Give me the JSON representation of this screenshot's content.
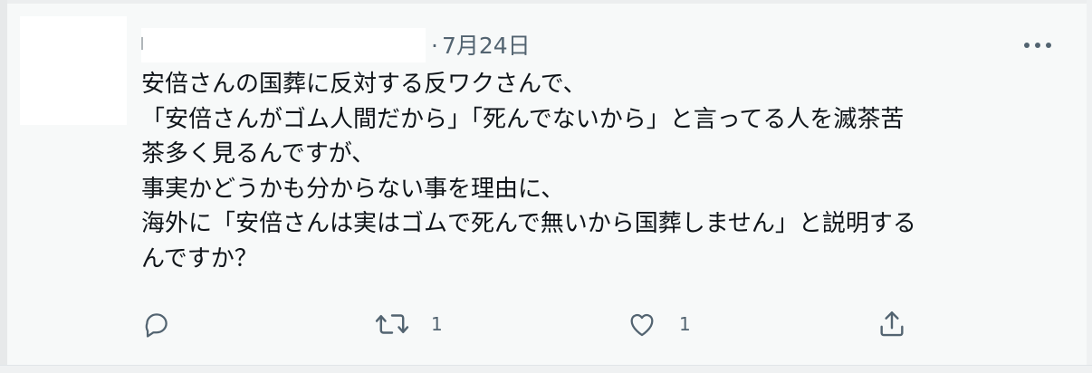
{
  "tweet": {
    "timestamp": "7月24日",
    "separator": "·",
    "text_lines": [
      "安倍さんの国葬に反対する反ワクさんで、",
      "「安倍さんがゴム人間だから」「死んでないから」と言ってる人を滅茶苦",
      "茶多く見るんですが、",
      "事実かどうかも分からない事を理由に、",
      "海外に「安倍さんは実はゴムで死んで無いから国葬しません」と説明する",
      "んですか？"
    ],
    "more_label": "•••",
    "actions": {
      "reply": {
        "icon": "reply-icon",
        "count": ""
      },
      "retweet": {
        "icon": "retweet-icon",
        "count": "1"
      },
      "like": {
        "icon": "heart-icon",
        "count": "1"
      },
      "share": {
        "icon": "share-icon",
        "count": ""
      }
    }
  },
  "colors": {
    "text": "#0f1419",
    "secondary": "#536471",
    "background": "#f7f9f9"
  }
}
